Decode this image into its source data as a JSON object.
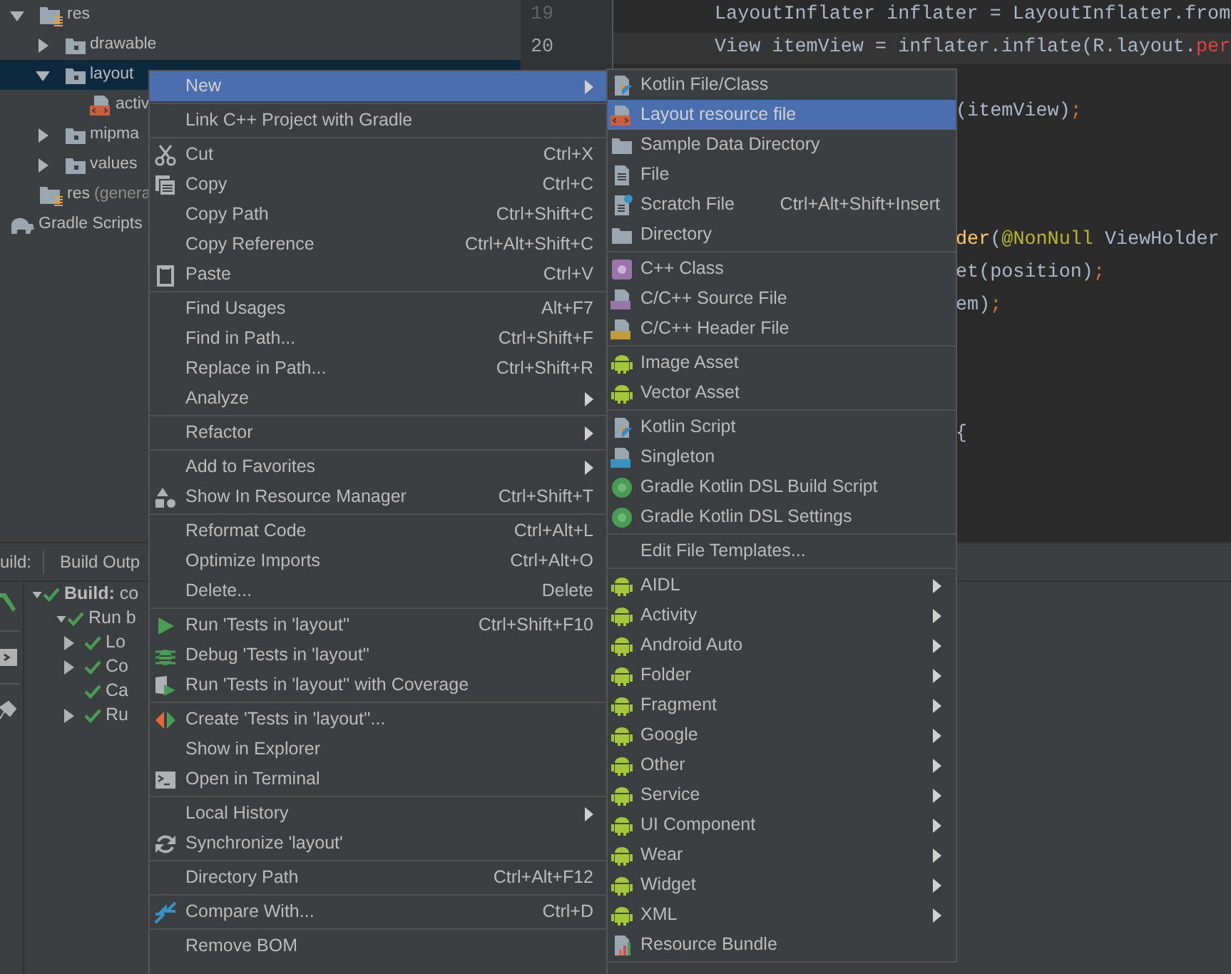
{
  "project_tree": [
    {
      "label": "res",
      "kind": "res",
      "expanded": true,
      "selected": false,
      "children": [
        {
          "label": "drawable",
          "kind": "folder",
          "expanded": false,
          "selected": false
        },
        {
          "label": "layout",
          "kind": "folder",
          "expanded": true,
          "selected": true,
          "children": [
            {
              "label": "activ",
              "kind": "layout-file",
              "selected": false
            }
          ]
        },
        {
          "label": "mipma",
          "kind": "folder",
          "expanded": false,
          "selected": false
        },
        {
          "label": "values",
          "kind": "folder",
          "expanded": false,
          "selected": false
        }
      ]
    },
    {
      "label": "res",
      "note": "(genera",
      "kind": "res",
      "selected": false
    },
    {
      "label": "Gradle Scripts",
      "kind": "gradle",
      "selected": false
    }
  ],
  "editor": {
    "line_numbers": [
      {
        "text": "19",
        "current": false
      },
      {
        "text": "20",
        "current": true
      }
    ],
    "lines": [
      {
        "kind": "full",
        "segments": [
          {
            "text": "LayoutInflater inflater = LayoutInflater.from",
            "color": "#a9b7c6"
          }
        ]
      },
      {
        "kind": "full",
        "segments": [
          {
            "text": "View itemView = inflater.inflate(R.layout.",
            "color": "#a9b7c6"
          },
          {
            "text": "per",
            "color": "#e0443e"
          }
        ]
      },
      {
        "kind": "partial",
        "segments": [
          {
            "text": "(itemView)",
            "color": "#a9b7c6"
          },
          {
            "text": ";",
            "color": "#cc7832"
          }
        ]
      },
      {
        "kind": "partial",
        "segments": [
          {
            "text": "der",
            "color": "#ffc66d"
          },
          {
            "text": "(",
            "color": "#a9b7c6"
          },
          {
            "text": "@NonNull",
            "color": "#bbb529"
          },
          {
            "text": " ViewHolder",
            "color": "#a9b7c6"
          }
        ]
      },
      {
        "kind": "partial",
        "segments": [
          {
            "text": "et(position)",
            "color": "#a9b7c6"
          },
          {
            "text": ";",
            "color": "#cc7832"
          }
        ]
      },
      {
        "kind": "partial",
        "segments": [
          {
            "text": "em)",
            "color": "#a9b7c6"
          },
          {
            "text": ";",
            "color": "#cc7832"
          }
        ]
      },
      {
        "kind": "partial",
        "segments": [
          {
            "text": "{",
            "color": "#a9b7c6"
          }
        ]
      }
    ]
  },
  "build_panel": {
    "title": "uild:",
    "tab": "Build Outp",
    "tree": [
      {
        "label": "**Build:** co",
        "expanded": true,
        "children": [
          {
            "label": "Run b",
            "expanded": true,
            "children": [
              {
                "label": "Lo",
                "expanded": false
              },
              {
                "label": "Co",
                "expanded": false
              },
              {
                "label": "Ca"
              },
              {
                "label": "Ru",
                "expanded": false
              }
            ]
          }
        ]
      }
    ]
  },
  "context_menu": {
    "groups": [
      [
        {
          "label": "New",
          "submenu": true,
          "selected": true
        }
      ],
      [
        {
          "label": "Link C++ Project with Gradle",
          "submenu": false,
          "selected": false
        }
      ],
      [
        {
          "label": "Cut",
          "kind": "cut",
          "shortcut": "Ctrl+X",
          "submenu": false,
          "selected": false
        },
        {
          "label": "Copy",
          "kind": "copy",
          "shortcut": "Ctrl+C",
          "submenu": false,
          "selected": false
        },
        {
          "label": "Copy Path",
          "shortcut": "Ctrl+Shift+C",
          "submenu": false,
          "selected": false
        },
        {
          "label": "Copy Reference",
          "shortcut": "Ctrl+Alt+Shift+C",
          "submenu": false,
          "selected": false
        },
        {
          "label": "Paste",
          "kind": "paste",
          "shortcut": "Ctrl+V",
          "submenu": false,
          "selected": false
        }
      ],
      [
        {
          "label": "Find Usages",
          "shortcut": "Alt+F7",
          "submenu": false,
          "selected": false
        },
        {
          "label": "Find in Path...",
          "shortcut": "Ctrl+Shift+F",
          "submenu": false,
          "selected": false
        },
        {
          "label": "Replace in Path...",
          "shortcut": "Ctrl+Shift+R",
          "submenu": false,
          "selected": false
        },
        {
          "label": "Analyze",
          "submenu": true,
          "selected": false
        }
      ],
      [
        {
          "label": "Refactor",
          "submenu": true,
          "selected": false
        }
      ],
      [
        {
          "label": "Add to Favorites",
          "submenu": true,
          "selected": false
        },
        {
          "label": "Show In Resource Manager",
          "kind": "resources",
          "shortcut": "Ctrl+Shift+T",
          "submenu": false,
          "selected": false
        }
      ],
      [
        {
          "label": "Reformat Code",
          "shortcut": "Ctrl+Alt+L",
          "submenu": false,
          "selected": false
        },
        {
          "label": "Optimize Imports",
          "shortcut": "Ctrl+Alt+O",
          "submenu": false,
          "selected": false
        },
        {
          "label": "Delete...",
          "shortcut": "Delete",
          "submenu": false,
          "selected": false
        }
      ],
      [
        {
          "label": "Run 'Tests in 'layout''",
          "kind": "run",
          "shortcut": "Ctrl+Shift+F10",
          "submenu": false,
          "selected": false
        },
        {
          "label": "Debug 'Tests in 'layout''",
          "kind": "debug",
          "submenu": false,
          "selected": false
        },
        {
          "label": "Run 'Tests in 'layout'' with Coverage",
          "kind": "coverage",
          "submenu": false,
          "selected": false
        }
      ],
      [
        {
          "label": "Create 'Tests in 'layout''...",
          "kind": "create-test",
          "submenu": false,
          "selected": false
        },
        {
          "label": "Show in Explorer",
          "submenu": false,
          "selected": false
        },
        {
          "label": "Open in Terminal",
          "kind": "terminal",
          "submenu": false,
          "selected": false
        }
      ],
      [
        {
          "label": "Local History",
          "submenu": true,
          "selected": false
        },
        {
          "label": "Synchronize 'layout'",
          "kind": "sync",
          "submenu": false,
          "selected": false
        }
      ],
      [
        {
          "label": "Directory Path",
          "shortcut": "Ctrl+Alt+F12",
          "submenu": false,
          "selected": false
        }
      ],
      [
        {
          "label": "Compare With...",
          "kind": "compare",
          "shortcut": "Ctrl+D",
          "submenu": false,
          "selected": false
        }
      ],
      [
        {
          "label": "Remove BOM",
          "submenu": false,
          "selected": false
        }
      ]
    ]
  },
  "new_submenu": {
    "groups": [
      [
        {
          "label": "Kotlin File/Class",
          "kind": "kotlin-file",
          "submenu": false,
          "selected": false
        },
        {
          "label": "Layout resource file",
          "kind": "layout-file",
          "submenu": false,
          "selected": true
        },
        {
          "label": "Sample Data Directory",
          "kind": "folder",
          "submenu": false,
          "selected": false
        },
        {
          "label": "File",
          "kind": "file",
          "submenu": false,
          "selected": false
        },
        {
          "label": "Scratch File",
          "kind": "scratch",
          "shortcut": "Ctrl+Alt+Shift+Insert",
          "submenu": false,
          "selected": false
        },
        {
          "label": "Directory",
          "kind": "folder",
          "submenu": false,
          "selected": false
        }
      ],
      [
        {
          "label": "C++ Class",
          "kind": "cpp-class",
          "submenu": false,
          "selected": false
        },
        {
          "label": "C/C++ Source File",
          "kind": "cpp-source",
          "submenu": false,
          "selected": false
        },
        {
          "label": "C/C++ Header File",
          "kind": "cpp-header",
          "submenu": false,
          "selected": false
        }
      ],
      [
        {
          "label": "Image Asset",
          "kind": "android",
          "submenu": false,
          "selected": false
        },
        {
          "label": "Vector Asset",
          "kind": "android",
          "submenu": false,
          "selected": false
        }
      ],
      [
        {
          "label": "Kotlin Script",
          "kind": "kotlin-file",
          "submenu": false,
          "selected": false
        },
        {
          "label": "Singleton",
          "kind": "singleton",
          "submenu": false,
          "selected": false
        },
        {
          "label": "Gradle Kotlin DSL Build Script",
          "kind": "gradle",
          "submenu": false,
          "selected": false
        },
        {
          "label": "Gradle Kotlin DSL Settings",
          "kind": "gradle",
          "submenu": false,
          "selected": false
        }
      ],
      [
        {
          "label": "Edit File Templates...",
          "submenu": false,
          "selected": false
        }
      ],
      [
        {
          "label": "AIDL",
          "kind": "android",
          "submenu": true,
          "selected": false
        },
        {
          "label": "Activity",
          "kind": "android",
          "submenu": true,
          "selected": false
        },
        {
          "label": "Android Auto",
          "kind": "android",
          "submenu": true,
          "selected": false
        },
        {
          "label": "Folder",
          "kind": "android",
          "submenu": true,
          "selected": false
        },
        {
          "label": "Fragment",
          "kind": "android",
          "submenu": true,
          "selected": false
        },
        {
          "label": "Google",
          "kind": "android",
          "submenu": true,
          "selected": false
        },
        {
          "label": "Other",
          "kind": "android",
          "submenu": true,
          "selected": false
        },
        {
          "label": "Service",
          "kind": "android",
          "submenu": true,
          "selected": false
        },
        {
          "label": "UI Component",
          "kind": "android",
          "submenu": true,
          "selected": false
        },
        {
          "label": "Wear",
          "kind": "android",
          "submenu": true,
          "selected": false
        },
        {
          "label": "Widget",
          "kind": "android",
          "submenu": true,
          "selected": false
        },
        {
          "label": "XML",
          "kind": "android",
          "submenu": true,
          "selected": false
        },
        {
          "label": "Resource Bundle",
          "kind": "bundle",
          "submenu": false,
          "selected": false
        }
      ]
    ]
  }
}
